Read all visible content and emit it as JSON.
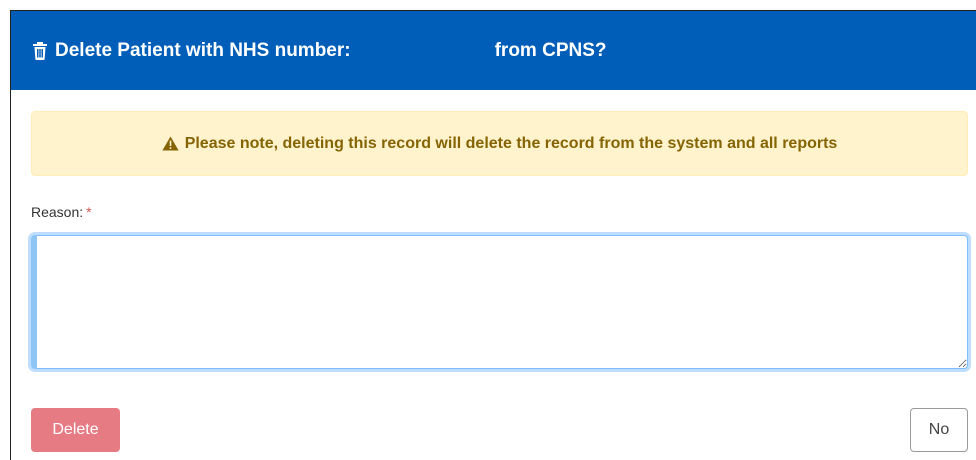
{
  "modal": {
    "title_prefix": "Delete Patient with NHS number:",
    "title_suffix": "from CPNS?",
    "header_color": "#005eb8",
    "header_icon": "trash-icon"
  },
  "alert": {
    "icon": "warning-triangle-icon",
    "message": "Please note, deleting this record will delete the record from the system and all reports"
  },
  "form": {
    "reason_label": "Reason:",
    "required_marker": "*",
    "reason_value": ""
  },
  "actions": {
    "delete_label": "Delete",
    "no_label": "No"
  }
}
